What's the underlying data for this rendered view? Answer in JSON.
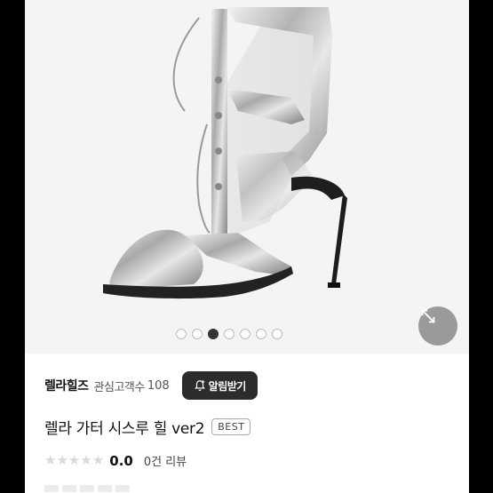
{
  "carousel": {
    "total_images": 7,
    "active_index": 2
  },
  "shop": {
    "name": "렐라힐즈",
    "followers_label": "관심고객수",
    "followers_count": "108",
    "alert_label": "알림받기"
  },
  "product": {
    "title": "렐라 가터 시스루 힐 ver2",
    "badge": "BEST"
  },
  "rating": {
    "stars_filled": 0,
    "stars_total": 5,
    "value": "0.0",
    "review_count": "0건 리뷰"
  },
  "colors": {
    "button_dark": "#2c2c2c",
    "star_empty": "#d9d9d9",
    "active_dot": "#333333",
    "expand_button": "#9a9a9a"
  },
  "icons": {
    "expand": "expand-arrows-icon",
    "bell": "bell-plus-icon",
    "star": "star-icon"
  }
}
